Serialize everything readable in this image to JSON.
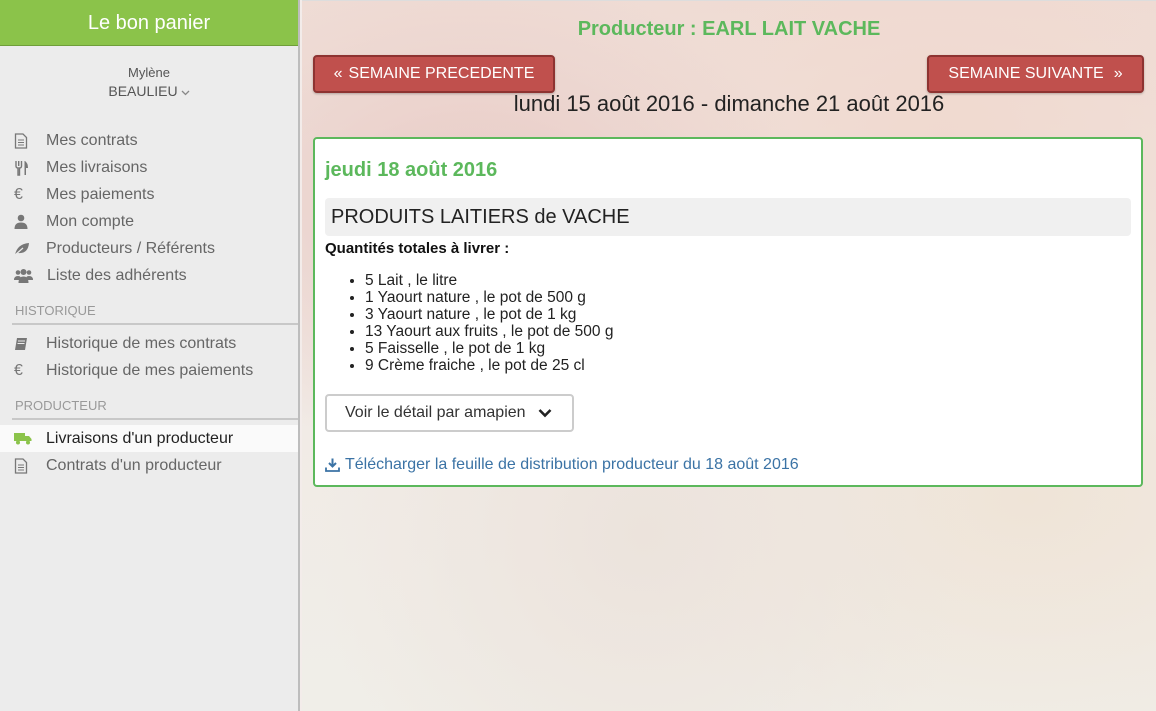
{
  "app": {
    "title": "Le bon panier"
  },
  "user": {
    "first_name": "Mylène",
    "last_name": "BEAULIEU"
  },
  "nav": {
    "main": [
      {
        "label": "Mes contrats",
        "icon": "document-icon"
      },
      {
        "label": "Mes livraisons",
        "icon": "cutlery-icon"
      },
      {
        "label": "Mes paiements",
        "icon": "euro-icon"
      },
      {
        "label": "Mon compte",
        "icon": "user-icon"
      },
      {
        "label": "Producteurs / Référents",
        "icon": "leaf-icon"
      },
      {
        "label": "Liste des adhérents",
        "icon": "users-icon"
      }
    ],
    "history_title": "HISTORIQUE",
    "history": [
      {
        "label": "Historique de mes contrats",
        "icon": "book-icon"
      },
      {
        "label": "Historique de mes paiements",
        "icon": "euro-icon"
      }
    ],
    "producer_title": "PRODUCTEUR",
    "producer": [
      {
        "label": "Livraisons d'un producteur",
        "icon": "truck-icon",
        "active": true
      },
      {
        "label": "Contrats d'un producteur",
        "icon": "document-icon"
      }
    ]
  },
  "main": {
    "producer_title": "Producteur : EARL LAIT VACHE",
    "prev_label": "SEMAINE PRECEDENTE",
    "next_label": "SEMAINE SUIVANTE",
    "week_range": "lundi 15 août 2016 - dimanche 21 août 2016",
    "day": "jeudi 18 août 2016",
    "product": "PRODUITS LAITIERS de VACHE",
    "qty_title": "Quantités totales à livrer :",
    "quantities": [
      "5 Lait , le litre",
      "1 Yaourt nature , le pot de 500 g",
      "3 Yaourt nature , le pot de 1 kg",
      "13 Yaourt aux fruits , le pot de 500 g",
      "5 Faisselle , le pot de 1 kg",
      "9 Crème fraiche , le pot de 25 cl"
    ],
    "detail_label": "Voir le détail par amapien",
    "download_label": "Télécharger la feuille de distribution producteur du 18 août 2016"
  },
  "colors": {
    "brand": "#8bc34a",
    "accent_green": "#5cb85c",
    "button_red": "#c0504d",
    "link_blue": "#3b73a5"
  }
}
